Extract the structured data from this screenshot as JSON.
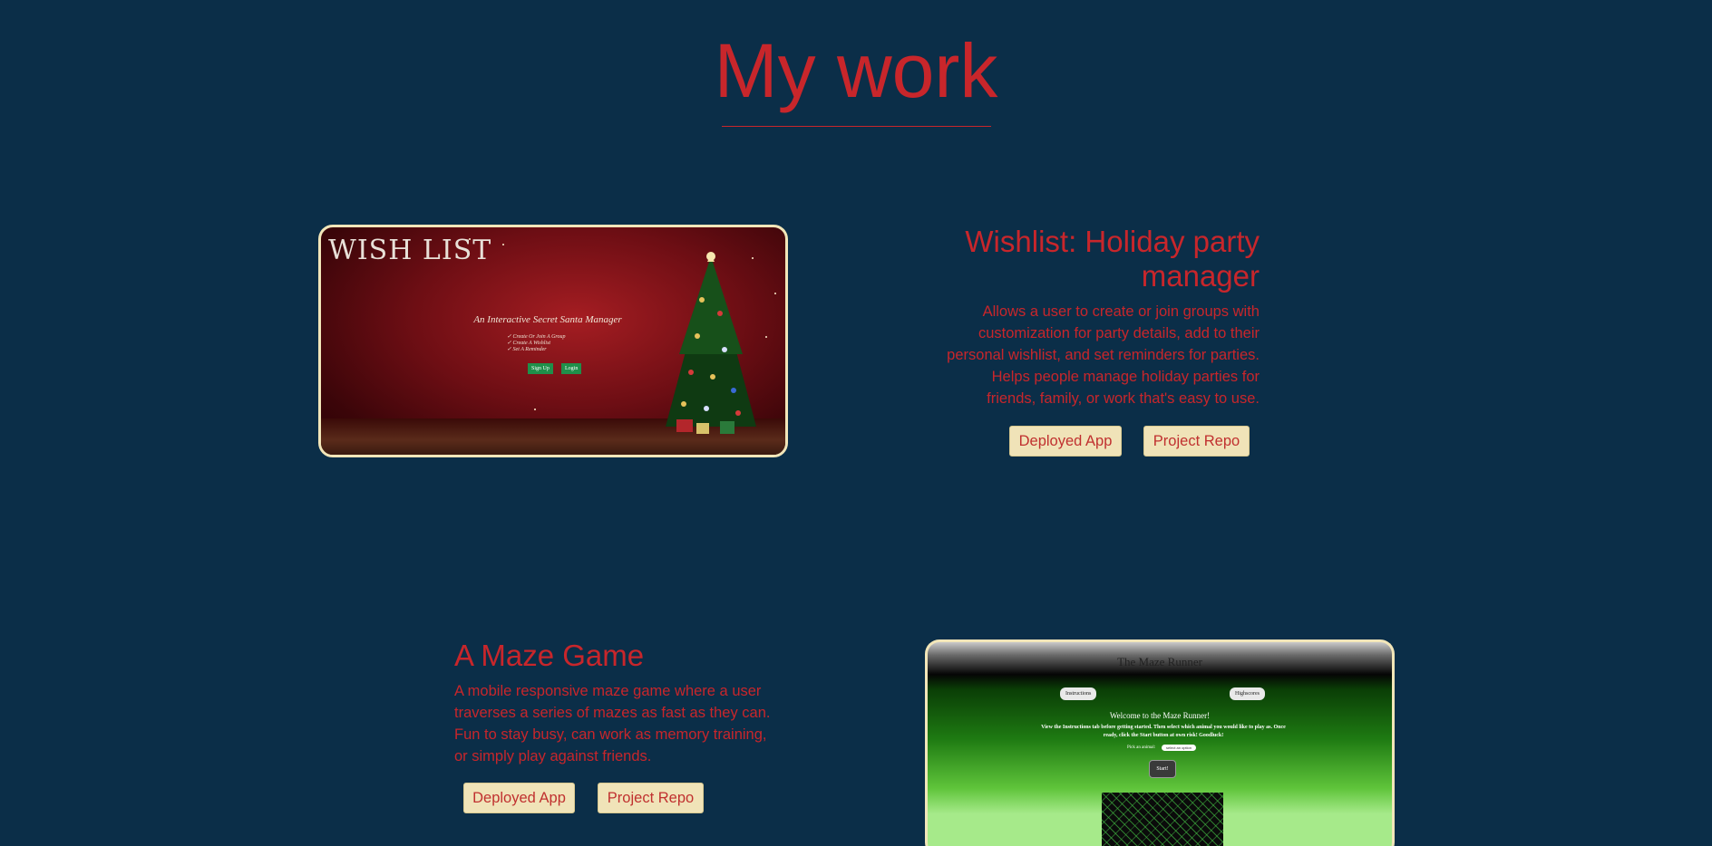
{
  "page": {
    "heading": "My work"
  },
  "projects": [
    {
      "title": "Wishlist: Holiday party manager",
      "description": "Allows a user to create or join groups with customization for party details, add to their personal wishlist, and set reminders for parties. Helps people manage holiday parties for friends, family, or work that's easy to use.",
      "buttons": {
        "deployed": "Deployed App",
        "repo": "Project Repo"
      },
      "screenshot": {
        "logo": "WISH LIST",
        "subtitle": "An Interactive Secret Santa Manager",
        "list": [
          "✓ Create Or Join A Group",
          "✓ Create A Wishlist",
          "✓ Set A Reminder"
        ],
        "signup": "Sign Up",
        "login": "Login"
      }
    },
    {
      "title": "A Maze Game",
      "description": "A mobile responsive maze game where a user traverses a series of mazes as fast as they can. Fun to stay busy, can work as memory training, or simply play against friends.",
      "buttons": {
        "deployed": "Deployed App",
        "repo": "Project Repo"
      },
      "screenshot": {
        "title": "The Maze Runner",
        "instructions_btn": "Instructions",
        "highscores_btn": "Highscores",
        "welcome": "Welcome to the Maze Runner!",
        "instructions_text": "View the Instructions tab before getting started. Then select which animal you would like to play as. Once ready, click the Start button at own risk! Goodluck!",
        "pick_label": "Pick an animal:",
        "select_value": "select an option",
        "start": "Start!"
      }
    }
  ],
  "colors": {
    "background": "#0b2e48",
    "accent": "#c8262b",
    "button_bg": "#f0e3b8",
    "frame": "#f2e6b9"
  }
}
